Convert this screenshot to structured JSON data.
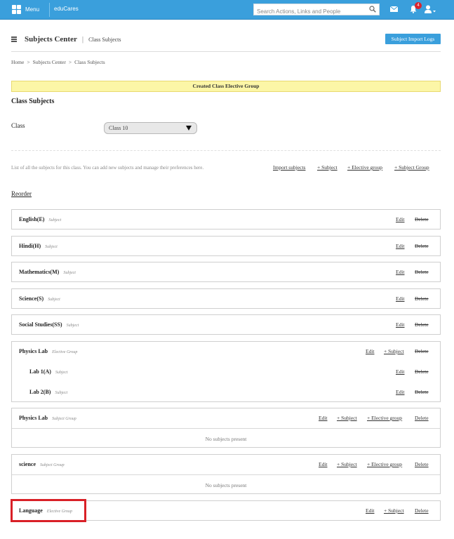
{
  "topbar": {
    "menu_label": "Menu",
    "brand": "eduCares",
    "search_placeholder": "Search Actions, Links and People",
    "notification_count": "4"
  },
  "header": {
    "title": "Subjects Center",
    "subtitle": "Class Subjects",
    "import_logs_label": "Subject Import Logs"
  },
  "breadcrumb": [
    "Home",
    "Subjects Center",
    "Class Subjects"
  ],
  "notice": "Created Class Elective Group",
  "main": {
    "title": "Class Subjects",
    "class_label": "Class",
    "class_value": "Class 10",
    "description": "List of all the subjects for this class. You can add new subjects and manage their preferences here.",
    "actions": [
      "Import subjects",
      "+ Subject",
      "+ Elective group",
      "+ Subject Group"
    ],
    "reorder_label": "Reorder"
  },
  "labels": {
    "edit": "Edit",
    "delete": "Delete",
    "add_subject": "+ Subject",
    "add_elective": "+ Elective group",
    "no_subjects": "No subjects present"
  },
  "subjects": [
    {
      "name": "English(E)",
      "type": "Subject"
    },
    {
      "name": "Hindi(H)",
      "type": "Subject"
    },
    {
      "name": "Mathematics(M)",
      "type": "Subject"
    },
    {
      "name": "Science(S)",
      "type": "Subject"
    },
    {
      "name": "Social Studies(SS)",
      "type": "Subject"
    }
  ],
  "elective_group": {
    "name": "Physics Lab",
    "type": "Elective Group",
    "children": [
      {
        "name": "Lab 1(A)",
        "type": "Subject"
      },
      {
        "name": "Lab 2(B)",
        "type": "Subject"
      }
    ]
  },
  "subject_groups": [
    {
      "name": "Physics Lab",
      "type": "Subject Group"
    },
    {
      "name": "science",
      "type": "Subject Group"
    }
  ],
  "language_group": {
    "name": "Language",
    "type": "Elective Group"
  },
  "colors": {
    "topbar": "#3a9fdc",
    "notice_bg": "#fcf6a7",
    "badge": "#d9232d",
    "highlight": "#d92027"
  }
}
